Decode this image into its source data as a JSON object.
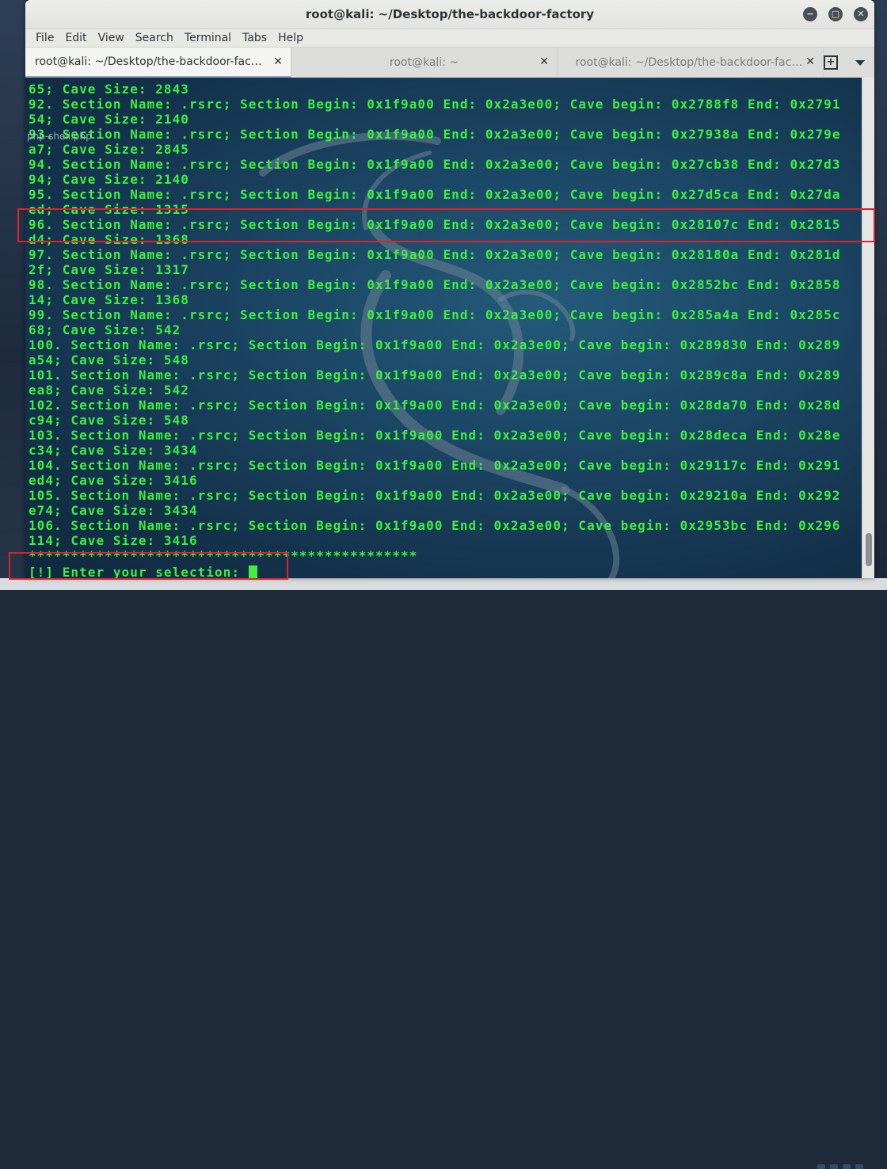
{
  "window": {
    "title": "root@kali: ~/Desktop/the-backdoor-factory",
    "controls": {
      "minimize": "−",
      "maximize": "▢",
      "close": "✕"
    }
  },
  "menubar": [
    "File",
    "Edit",
    "View",
    "Search",
    "Terminal",
    "Tabs",
    "Help"
  ],
  "tabs": [
    {
      "label": "root@kali: ~/Desktop/the-backdoor-fact…",
      "active": true
    },
    {
      "label": "root@kali: ~",
      "active": false
    },
    {
      "label": "root@kali: ~/Desktop/the-backdoor-fact…",
      "active": false
    }
  ],
  "tab_close_glyph": "✕",
  "desktop_label": "php-shell.php",
  "terminal": {
    "colors": {
      "text": "#3cf03c",
      "highlight": "#e0202a"
    },
    "lines": [
      "65; Cave Size: 2843",
      "92. Section Name: .rsrc; Section Begin: 0x1f9a00 End: 0x2a3e00; Cave begin: 0x2788f8 End: 0x2791",
      "54; Cave Size: 2140",
      "93. Section Name: .rsrc; Section Begin: 0x1f9a00 End: 0x2a3e00; Cave begin: 0x27938a End: 0x279e",
      "a7; Cave Size: 2845",
      "94. Section Name: .rsrc; Section Begin: 0x1f9a00 End: 0x2a3e00; Cave begin: 0x27cb38 End: 0x27d3",
      "94; Cave Size: 2140",
      "95. Section Name: .rsrc; Section Begin: 0x1f9a00 End: 0x2a3e00; Cave begin: 0x27d5ca End: 0x27da",
      "ed; Cave Size: 1315",
      "96. Section Name: .rsrc; Section Begin: 0x1f9a00 End: 0x2a3e00; Cave begin: 0x28107c End: 0x2815",
      "d4; Cave Size: 1368",
      "97. Section Name: .rsrc; Section Begin: 0x1f9a00 End: 0x2a3e00; Cave begin: 0x28180a End: 0x281d",
      "2f; Cave Size: 1317",
      "98. Section Name: .rsrc; Section Begin: 0x1f9a00 End: 0x2a3e00; Cave begin: 0x2852bc End: 0x2858",
      "14; Cave Size: 1368",
      "99. Section Name: .rsrc; Section Begin: 0x1f9a00 End: 0x2a3e00; Cave begin: 0x285a4a End: 0x285c",
      "68; Cave Size: 542",
      "100. Section Name: .rsrc; Section Begin: 0x1f9a00 End: 0x2a3e00; Cave begin: 0x289830 End: 0x289",
      "a54; Cave Size: 548",
      "101. Section Name: .rsrc; Section Begin: 0x1f9a00 End: 0x2a3e00; Cave begin: 0x289c8a End: 0x289",
      "ea8; Cave Size: 542",
      "102. Section Name: .rsrc; Section Begin: 0x1f9a00 End: 0x2a3e00; Cave begin: 0x28da70 End: 0x28d",
      "c94; Cave Size: 548",
      "103. Section Name: .rsrc; Section Begin: 0x1f9a00 End: 0x2a3e00; Cave begin: 0x28deca End: 0x28e",
      "c34; Cave Size: 3434",
      "104. Section Name: .rsrc; Section Begin: 0x1f9a00 End: 0x2a3e00; Cave begin: 0x29117c End: 0x291",
      "ed4; Cave Size: 3416",
      "105. Section Name: .rsrc; Section Begin: 0x1f9a00 End: 0x2a3e00; Cave begin: 0x29210a End: 0x292",
      "e74; Cave Size: 3434",
      "106. Section Name: .rsrc; Section Begin: 0x1f9a00 End: 0x2a3e00; Cave begin: 0x2953bc End: 0x296",
      "114; Cave Size: 3416",
      "**********************************************"
    ],
    "prompt": "[!] Enter your selection: "
  }
}
